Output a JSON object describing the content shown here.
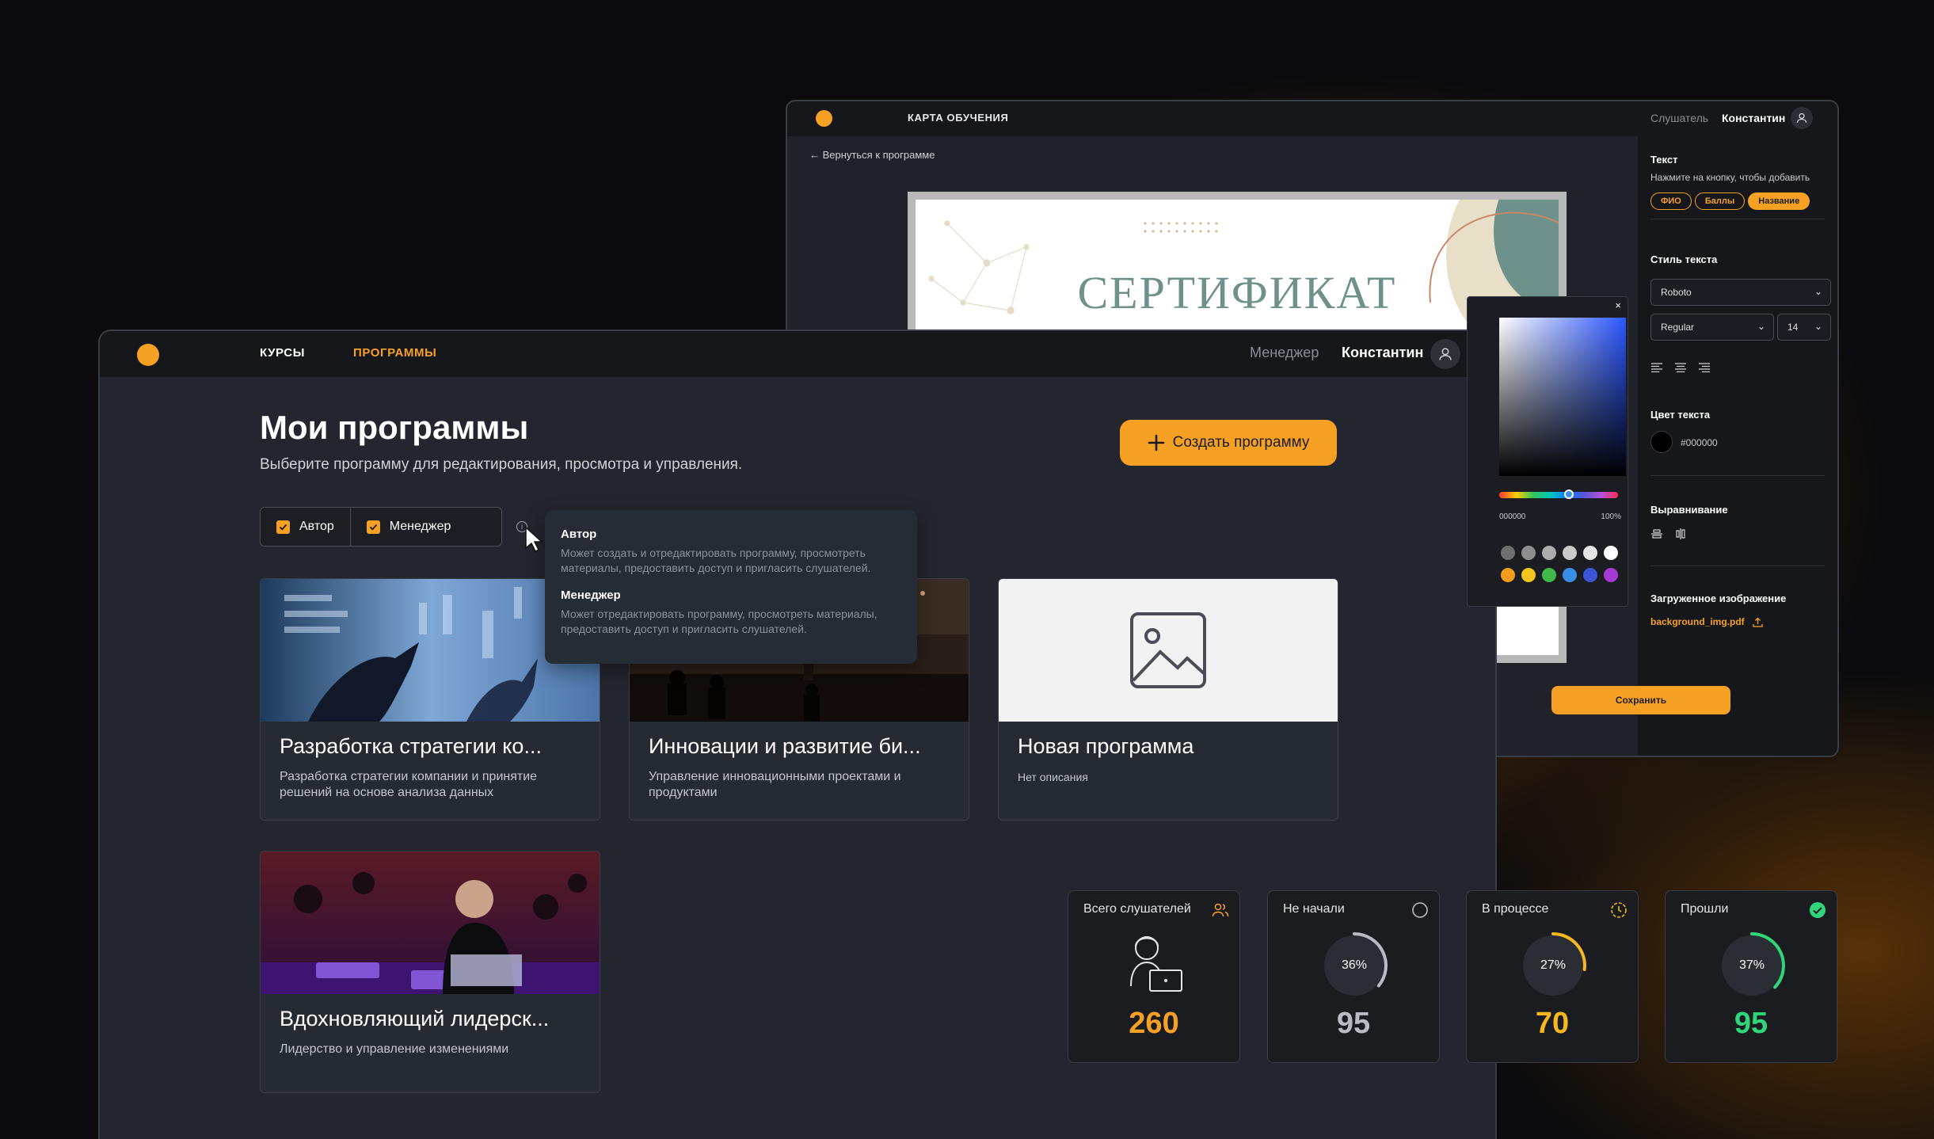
{
  "back_window": {
    "title": "КАРТА ОБУЧЕНИЯ",
    "role": "Слушатель",
    "user": "Константин",
    "back_link": "Вернуться к программе",
    "certificate_title": "СЕРТИФИКАТ",
    "sidebar": {
      "text_heading": "Текст",
      "text_hint": "Нажмите на кнопку, чтобы добавить",
      "pills": [
        "ФИО",
        "Баллы",
        "Название"
      ],
      "style_heading": "Стиль текста",
      "font_family": "Roboto",
      "font_weight": "Regular",
      "font_size": "14",
      "color_heading": "Цвет текста",
      "color_value": "#000000",
      "align_heading": "Выравнивание",
      "upload_heading": "Загруженное изображение",
      "upload_file": "background_img.pdf"
    },
    "save_label": "Сохранить",
    "picker": {
      "hex": "000000",
      "alpha": "100%",
      "swatches_row1": [
        "#6e6e6e",
        "#8e8e8e",
        "#adadad",
        "#c9c9c9",
        "#e4e4e4",
        "#ffffff"
      ],
      "swatches_row2": [
        "#f39c1e",
        "#f4c51d",
        "#3fb94a",
        "#3a8ee6",
        "#3a55d8",
        "#a43ad8"
      ]
    }
  },
  "front_window": {
    "nav": [
      "КУРСЫ",
      "ПРОГРАММЫ"
    ],
    "role": "Менеджер",
    "user": "Константин",
    "title": "Мои программы",
    "subtitle": "Выберите программу для редактирования, просмотра и управления.",
    "create_label": "Создать программу",
    "filters": [
      "Автор",
      "Менеджер"
    ],
    "info_symbol": "i",
    "tooltip": {
      "author_title": "Автор",
      "author_text": "Может создать и отредактировать программу, просмотреть материалы, предоставить доступ и пригласить слушателей.",
      "manager_title": "Менеджер",
      "manager_text": "Может отредактировать программу, просмотреть материалы, предоставить доступ и пригласить слушателей."
    },
    "cards": [
      {
        "title": "Разработка стратегии ко...",
        "desc": "Разработка стратегии компании и принятие решений на основе анализа данных"
      },
      {
        "title": "Инновации и развитие би...",
        "desc": "Управление инновационными проектами и продуктами"
      },
      {
        "title": "Новая программа",
        "desc": "Нет описания"
      },
      {
        "title": "Вдохновляющий лидерск...",
        "desc": "Лидерство и управление изменениями"
      }
    ]
  },
  "stats": [
    {
      "label": "Всего слушателей",
      "value": "260",
      "color": "#f6a124"
    },
    {
      "label": "Не начали",
      "value": "95",
      "percent": "36%",
      "fraction": 0.36,
      "color": "#b9bcc2"
    },
    {
      "label": "В процессе",
      "value": "70",
      "percent": "27%",
      "fraction": 0.27,
      "color": "#f6b820"
    },
    {
      "label": "Прошли",
      "value": "95",
      "percent": "37%",
      "fraction": 0.37,
      "color": "#2fd67a"
    }
  ],
  "colors": {
    "accent": "#f6a124",
    "success": "#2fd67a"
  }
}
